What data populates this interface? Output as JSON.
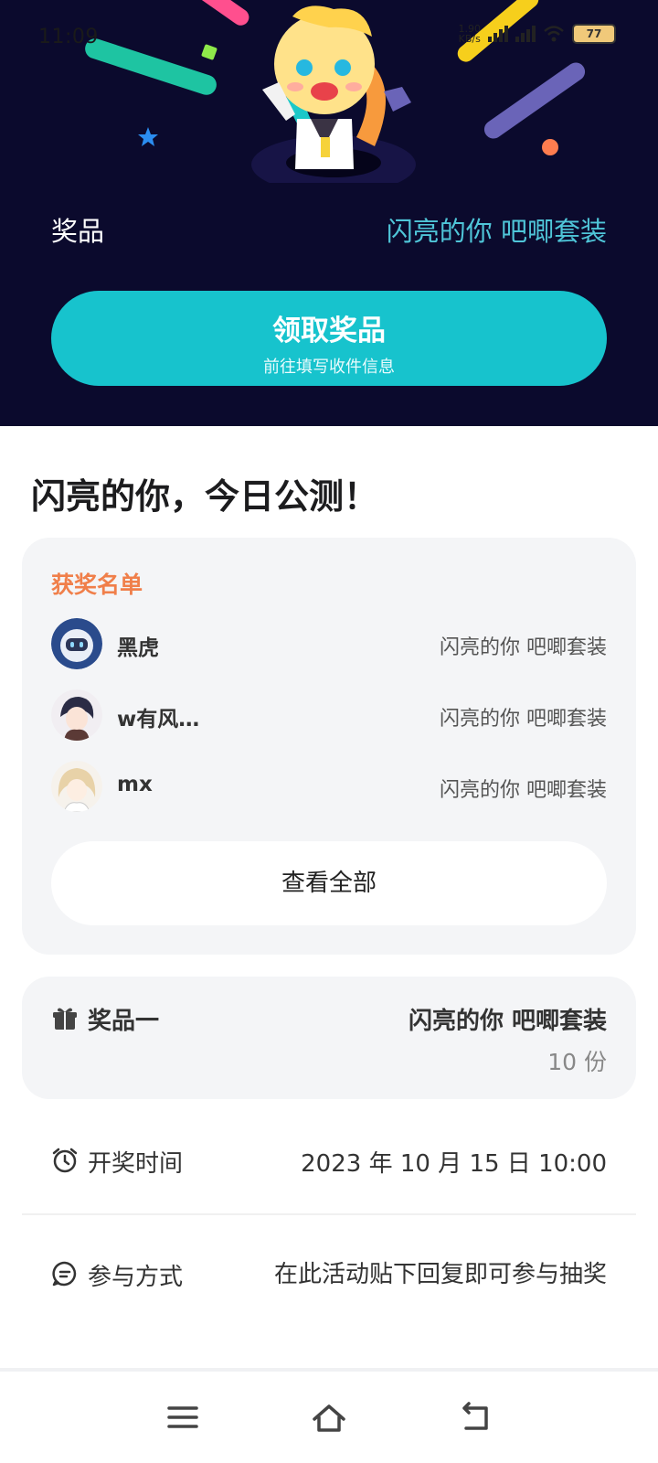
{
  "status_bar": {
    "time": "11:09",
    "net_speed_value": "1.90",
    "net_speed_unit": "KB/s",
    "battery": "77"
  },
  "hero": {
    "prize_label": "奖品",
    "prize_value": "闪亮的你 吧唧套装",
    "claim_button_title": "领取奖品",
    "claim_button_subtitle": "前往填写收件信息"
  },
  "page_title": "闪亮的你，今日公测！",
  "winners": {
    "heading": "获奖名单",
    "items": [
      {
        "name": "黑虎",
        "prize": "闪亮的你 吧唧套装"
      },
      {
        "name": "w有风…",
        "prize": "闪亮的你 吧唧套装"
      },
      {
        "name": "mx",
        "prize": "闪亮的你 吧唧套装"
      }
    ],
    "view_all_label": "查看全部"
  },
  "prize": {
    "label": "奖品一",
    "name": "闪亮的你 吧唧套装",
    "quantity": "10 份"
  },
  "draw_time": {
    "label": "开奖时间",
    "value": "2023 年 10 月 15 日 10:00"
  },
  "participation": {
    "label": "参与方式",
    "value": "在此活动贴下回复即可参与抽奖"
  },
  "colors": {
    "hero_bg": "#0b0a2d",
    "accent_teal": "#17c3cd",
    "winners_heading": "#f07f4a",
    "prize_value_hero": "#4fc5d8"
  },
  "icons": {
    "gift": "gift-icon",
    "alarm": "alarm-clock-icon",
    "chat": "chat-bubble-icon",
    "nav_menu": "menu-icon",
    "nav_home": "home-icon",
    "nav_back": "back-icon"
  }
}
